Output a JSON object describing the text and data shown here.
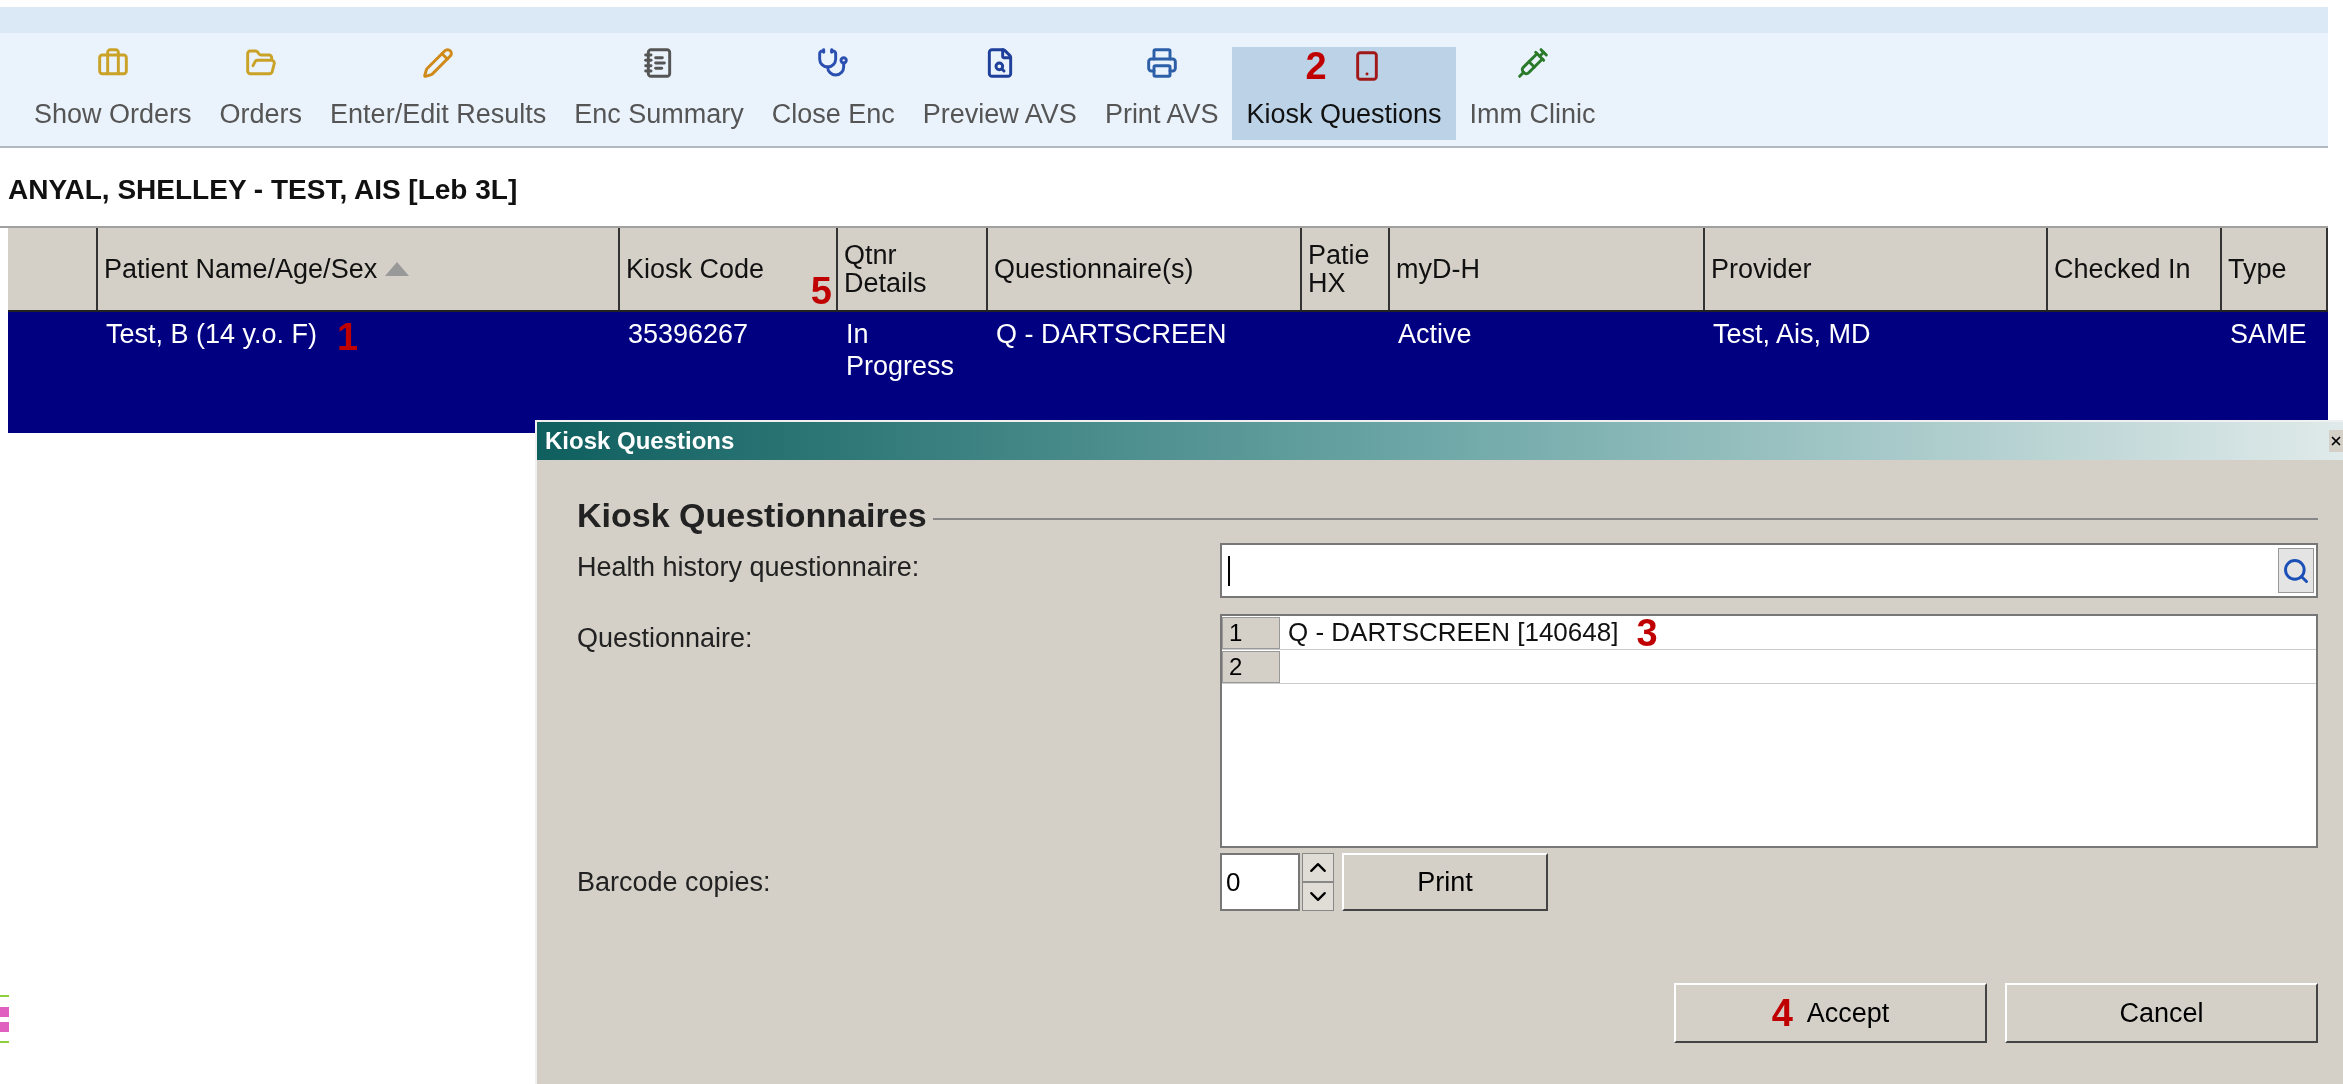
{
  "toolbar": [
    {
      "label": "Show Orders",
      "selected": false
    },
    {
      "label": "Orders",
      "selected": false
    },
    {
      "label": "Enter/Edit Results",
      "selected": false
    },
    {
      "label": "Enc Summary",
      "selected": false
    },
    {
      "label": "Close Enc",
      "selected": false
    },
    {
      "label": "Preview AVS",
      "selected": false
    },
    {
      "label": "Print AVS",
      "selected": false
    },
    {
      "label": "Kiosk Questions",
      "selected": true,
      "callout": "2"
    },
    {
      "label": "Imm Clinic",
      "selected": false
    }
  ],
  "patient_header": "ANYAL, SHELLEY - TEST, AIS [Leb 3L]",
  "table": {
    "columns": [
      {
        "label": "Patient Name/Age/Sex",
        "sorted": true
      },
      {
        "label": "Kiosk Code",
        "callout": "5"
      },
      {
        "label": "Qtnr Details"
      },
      {
        "label": "Questionnaire(s)"
      },
      {
        "label": "Patie HX"
      },
      {
        "label": "myD-H"
      },
      {
        "label": "Provider"
      },
      {
        "label": "Checked In"
      },
      {
        "label": "Type"
      }
    ],
    "rows": [
      {
        "selected": true,
        "callout": "1",
        "cells": [
          "Test,  B (14 y.o. F)",
          "35396267",
          "In Progress",
          "Q - DARTSCREEN",
          "",
          "Active",
          "Test, Ais, MD",
          "",
          "SAME"
        ]
      }
    ]
  },
  "dialog": {
    "title": "Kiosk Questions",
    "heading": "Kiosk Questionnaires",
    "health_history": {
      "label": "Health history questionnaire:"
    },
    "questionnaire": {
      "label": "Questionnaire:",
      "rows": [
        {
          "number": "1",
          "value": "Q - DARTSCREEN [140648]",
          "callout": "3"
        },
        {
          "number": "2",
          "value": ""
        }
      ]
    },
    "barcode": {
      "label": "Barcode copies:",
      "value": "0",
      "button": "Print"
    },
    "buttons": [
      {
        "label": "Accept",
        "callout": "4"
      },
      {
        "label": "Cancel"
      }
    ]
  }
}
